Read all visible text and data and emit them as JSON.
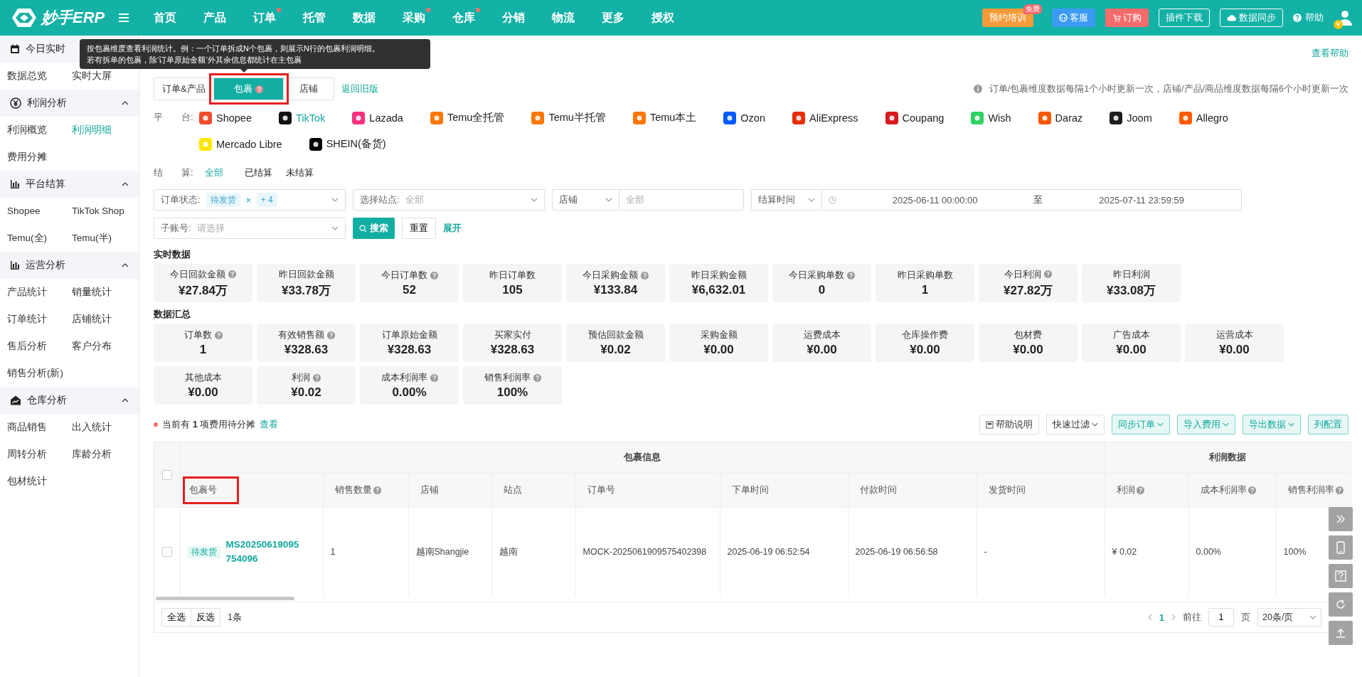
{
  "topbar": {
    "logo": "妙手ERP",
    "nav": [
      {
        "label": "首页",
        "dot": false
      },
      {
        "label": "产品",
        "dot": false
      },
      {
        "label": "订单",
        "dot": true
      },
      {
        "label": "托管",
        "dot": false
      },
      {
        "label": "数据",
        "dot": false
      },
      {
        "label": "采购",
        "dot": true
      },
      {
        "label": "仓库",
        "dot": true
      },
      {
        "label": "分销",
        "dot": false
      },
      {
        "label": "物流",
        "dot": false
      },
      {
        "label": "更多",
        "dot": false
      },
      {
        "label": "授权",
        "dot": false
      }
    ],
    "buttons": [
      {
        "kind": "training",
        "label": "预约培训",
        "badge": "免费"
      },
      {
        "kind": "service",
        "label": "客服"
      },
      {
        "kind": "order",
        "label": "订购"
      },
      {
        "kind": "outline",
        "label": "插件下载"
      },
      {
        "kind": "sync",
        "label": "数据同步"
      }
    ],
    "help": "帮助",
    "vip_badge": "V"
  },
  "sidebar": {
    "sections": [
      {
        "title": "今日实时",
        "items": [
          {
            "label": "数据总览",
            "selected": false
          },
          {
            "label": "实时大屏",
            "selected": false
          }
        ]
      },
      {
        "title": "利润分析",
        "expanded": true,
        "items": [
          {
            "label": "利润概览",
            "selected": false
          },
          {
            "label": "利润明细",
            "selected": true
          },
          {
            "label": "费用分摊",
            "selected": false
          }
        ]
      },
      {
        "title": "平台结算",
        "expanded": true,
        "items": [
          {
            "label": "Shopee",
            "selected": false
          },
          {
            "label": "TikTok Shop",
            "selected": false
          },
          {
            "label": "Temu(全)",
            "selected": false
          },
          {
            "label": "Temu(半)",
            "selected": false
          }
        ]
      },
      {
        "title": "运营分析",
        "expanded": true,
        "items": [
          {
            "label": "产品统计",
            "selected": false
          },
          {
            "label": "销量统计",
            "selected": false
          },
          {
            "label": "订单统计",
            "selected": false
          },
          {
            "label": "店铺统计",
            "selected": false
          },
          {
            "label": "售后分析",
            "selected": false
          },
          {
            "label": "客户分布",
            "selected": false
          },
          {
            "label": "销售分析(新)",
            "selected": false
          }
        ]
      },
      {
        "title": "仓库分析",
        "expanded": true,
        "items": [
          {
            "label": "商品销售",
            "selected": false
          },
          {
            "label": "出入统计",
            "selected": false
          },
          {
            "label": "周转分析",
            "selected": false
          },
          {
            "label": "库龄分析",
            "selected": false
          },
          {
            "label": "包材统计",
            "selected": false
          }
        ]
      }
    ]
  },
  "tooltip": [
    "按包裹维度查看利润统计。例：一个订单拆成N个包裹，则展示N行的包裹利润明细。",
    "若有拆单的包裹，除‘订单原始金额’外其余信息都统计在主包裹"
  ],
  "help_link": "查看帮助",
  "tabs": [
    {
      "label": "订单&产品",
      "selected": false,
      "help": false,
      "highlighted": false
    },
    {
      "label": "包裹",
      "selected": true,
      "help": true,
      "highlighted": true
    },
    {
      "label": "店铺",
      "selected": false,
      "help": false,
      "highlighted": false
    }
  ],
  "old_version_link": "返回旧版",
  "update_note": "订单/包裹维度数据每隔1个小时更新一次，店铺/产品/商品维度数据每隔6个小时更新一次",
  "platform_label": "平　　台:",
  "platforms": [
    {
      "name": "Shopee",
      "color": "#ee4d2d",
      "selected": false
    },
    {
      "name": "TikTok",
      "color": "#111111",
      "selected": true
    },
    {
      "name": "Lazada",
      "color": "#f5317f",
      "selected": false
    },
    {
      "name": "Temu全托管",
      "color": "#fb7701",
      "selected": false
    },
    {
      "name": "Temu半托管",
      "color": "#fb7701",
      "selected": false
    },
    {
      "name": "Temu本土",
      "color": "#fb7701",
      "selected": false
    },
    {
      "name": "Ozon",
      "color": "#005bff",
      "selected": false
    },
    {
      "name": "AliExpress",
      "color": "#e62e04",
      "selected": false
    },
    {
      "name": "Coupang",
      "color": "#d71a21",
      "selected": false
    },
    {
      "name": "Wish",
      "color": "#2fd164",
      "selected": false
    },
    {
      "name": "Daraz",
      "color": "#f85606",
      "selected": false
    },
    {
      "name": "Joom",
      "color": "#1d1d1b",
      "selected": false
    },
    {
      "name": "Allegro",
      "color": "#ff5a00",
      "selected": false
    },
    {
      "name": "Mercado Libre",
      "color": "#ffe600",
      "selected": false
    },
    {
      "name": "SHEIN(备货)",
      "color": "#000000",
      "selected": false
    }
  ],
  "settle_label": "结　　算:",
  "settle_options": [
    {
      "label": "全部",
      "selected": true
    },
    {
      "label": "已结算",
      "selected": false
    },
    {
      "label": "未结算",
      "selected": false
    }
  ],
  "filters": {
    "order_status": {
      "label": "订单状态:",
      "tag": "待发货",
      "more": "+ 4"
    },
    "site": {
      "label": "选择站点:",
      "placeholder": "全部"
    },
    "shop": {
      "label": "店铺",
      "placeholder": "全部"
    },
    "time": {
      "label": "结算时间",
      "start": "2025-06-11 00:00:00",
      "sep": "至",
      "end": "2025-07-11 23:59:59"
    },
    "sub_account": {
      "label": "子账号:",
      "placeholder": "请选择"
    },
    "search": "搜索",
    "reset": "重置",
    "expand": "展开"
  },
  "realtime": {
    "title": "实时数据",
    "cards": [
      {
        "label": "今日回款金额",
        "help": true,
        "value": "¥27.84万"
      },
      {
        "label": "昨日回款金额",
        "help": false,
        "value": "¥33.78万"
      },
      {
        "label": "今日订单数",
        "help": true,
        "value": "52"
      },
      {
        "label": "昨日订单数",
        "help": false,
        "value": "105"
      },
      {
        "label": "今日采购金额",
        "help": true,
        "value": "¥133.84"
      },
      {
        "label": "昨日采购金额",
        "help": false,
        "value": "¥6,632.01"
      },
      {
        "label": "今日采购单数",
        "help": true,
        "value": "0"
      },
      {
        "label": "昨日采购单数",
        "help": false,
        "value": "1"
      },
      {
        "label": "今日利润",
        "help": true,
        "value": "¥27.82万"
      },
      {
        "label": "昨日利润",
        "help": false,
        "value": "¥33.08万"
      }
    ]
  },
  "summary": {
    "title": "数据汇总",
    "cards": [
      {
        "label": "订单数",
        "help": true,
        "value": "1"
      },
      {
        "label": "有效销售额",
        "help": true,
        "value": "¥328.63"
      },
      {
        "label": "订单原始金额",
        "help": false,
        "value": "¥328.63"
      },
      {
        "label": "买家实付",
        "help": false,
        "value": "¥328.63"
      },
      {
        "label": "预估回款金额",
        "help": false,
        "value": "¥0.02"
      },
      {
        "label": "采购金额",
        "help": false,
        "value": "¥0.00"
      },
      {
        "label": "运费成本",
        "help": false,
        "value": "¥0.00"
      },
      {
        "label": "仓库操作费",
        "help": false,
        "value": "¥0.00"
      },
      {
        "label": "包材费",
        "help": false,
        "value": "¥0.00"
      },
      {
        "label": "广告成本",
        "help": false,
        "value": "¥0.00"
      },
      {
        "label": "运营成本",
        "help": false,
        "value": "¥0.00"
      },
      {
        "label": "其他成本",
        "help": false,
        "value": "¥0.00"
      },
      {
        "label": "利润",
        "help": true,
        "value": "¥0.02"
      },
      {
        "label": "成本利润率",
        "help": true,
        "value": "0.00%"
      },
      {
        "label": "销售利润率",
        "help": true,
        "value": "100%"
      }
    ]
  },
  "notice": {
    "text": "当前有 **1** 项费用待分摊",
    "link": "查看"
  },
  "actions": [
    {
      "kind": "help",
      "label": "帮助说明"
    },
    {
      "kind": "dropdown",
      "label": "快速过滤"
    },
    {
      "kind": "primary-dropdown",
      "label": "同步订单"
    },
    {
      "kind": "primary-dropdown",
      "label": "导入费用"
    },
    {
      "kind": "primary-dropdown",
      "label": "导出数据"
    },
    {
      "kind": "primary",
      "label": "列配置"
    }
  ],
  "table": {
    "all_checked": false,
    "groups": [
      {
        "label": "包裹信息"
      },
      {
        "label": "利润数据"
      }
    ],
    "columns": [
      {
        "label": "包裹号",
        "help": false,
        "highlighted": true
      },
      {
        "label": "销售数量",
        "help": true,
        "highlighted": false
      },
      {
        "label": "店铺",
        "help": false,
        "highlighted": false
      },
      {
        "label": "站点",
        "help": false,
        "highlighted": false
      },
      {
        "label": "订单号",
        "help": false,
        "highlighted": false
      },
      {
        "label": "下单时间",
        "help": false,
        "highlighted": false
      },
      {
        "label": "付款时间",
        "help": false,
        "highlighted": false
      },
      {
        "label": "发货时间",
        "help": false,
        "highlighted": false
      },
      {
        "label": "利润",
        "help": true,
        "highlighted": false
      },
      {
        "label": "成本利润率",
        "help": true,
        "highlighted": false
      },
      {
        "label": "销售利润率",
        "help": true,
        "highlighted": false
      }
    ],
    "rows": [
      {
        "checked": false,
        "cells": [
          {
            "tag": "待发货",
            "text": "MS20250619095754096"
          },
          {
            "text": "1"
          },
          {
            "text": "越南Shangjie"
          },
          {
            "text": "越南"
          },
          {
            "text": "MOCK-2025061909575402398"
          },
          {
            "text": "2025-06-19 06:52:54"
          },
          {
            "text": "2025-06-19 06:56:58"
          },
          {
            "text": "-"
          },
          {
            "text": "¥ 0.02"
          },
          {
            "text": "0.00%"
          },
          {
            "text": "100%"
          }
        ]
      }
    ]
  },
  "footer": {
    "select_all": "全选",
    "invert": "反选",
    "count": "1条"
  },
  "pagination": {
    "pages": [
      {
        "label": "1",
        "selected": true
      }
    ],
    "goto": "前往",
    "page_value": "1",
    "page_unit": "页",
    "page_size": "20条/页"
  }
}
